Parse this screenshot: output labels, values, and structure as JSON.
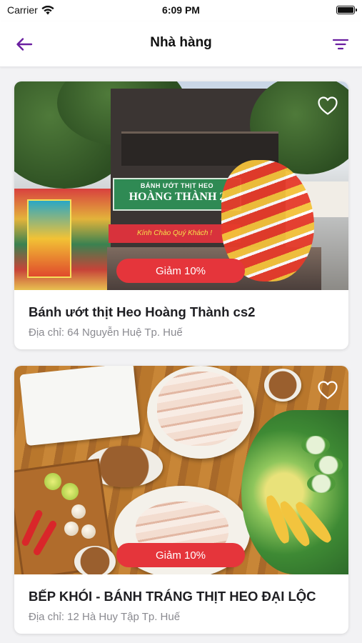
{
  "status_bar": {
    "carrier": "Carrier",
    "time": "6:09 PM"
  },
  "nav": {
    "title": "Nhà hàng",
    "back_icon": "arrow-left-icon",
    "filter_icon": "filter-lines-icon"
  },
  "colors": {
    "accent": "#6a1fa0",
    "badge": "#e5353b"
  },
  "restaurants": [
    {
      "name": "Bánh ướt thịt Heo Hoàng Thành cs2",
      "address": "Địa chỉ: 64 Nguyễn Huệ Tp. Huế",
      "discount": "Giảm 10%",
      "favorite_icon": "heart-outline-icon",
      "image_sign_top": "BÁNH ƯỚT THỊT HEO",
      "image_sign_main": "HOÀNG THÀNH 2",
      "image_sign_bottom": "Kính Chào Quý Khách !"
    },
    {
      "name": "BẾP KHÓI - BÁNH TRÁNG THỊT HEO ĐẠI LỘC",
      "address": "Địa chỉ: 12 Hà Huy Tập Tp. Huế",
      "discount": "Giảm 10%",
      "favorite_icon": "heart-outline-icon"
    }
  ]
}
